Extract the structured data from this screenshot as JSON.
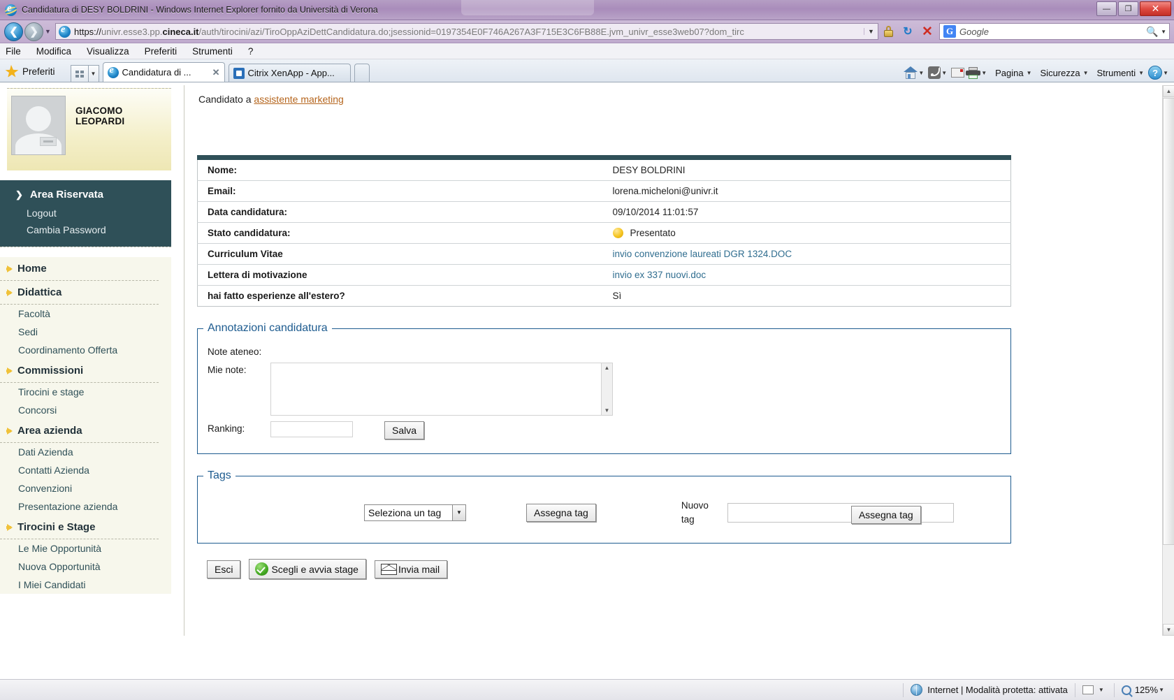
{
  "window": {
    "title": "Candidatura di DESY BOLDRINI - Windows Internet Explorer fornito da Università di Verona",
    "minimize_label": "—",
    "maximize_label": "❐",
    "close_label": "✕"
  },
  "address_bar": {
    "back_label": "❮",
    "forward_label": "❯",
    "history_caret": "▼",
    "url_scheme": "https://",
    "url_host_pre": "univr.esse3.pp.",
    "url_host_bold": "cineca.it",
    "url_path": "/auth/tirocini/azi/TiroOppAziDettCandidatura.do;jsessionid=0197354E0F746A267A3F715E3C6FB88E.jvm_univr_esse3web07?dom_tirc",
    "url_dropdown_caret": "▼",
    "lock_icon": "lock-icon",
    "refresh_label": "↻",
    "stop_label": "✕",
    "search_engine": "Google",
    "search_placeholder": "Google",
    "search_icon": "search-icon",
    "search_caret": "▼"
  },
  "menu_bar": {
    "items": [
      "File",
      "Modifica",
      "Visualizza",
      "Preferiti",
      "Strumenti",
      "?"
    ]
  },
  "tab_bar": {
    "favorites_label": "Preferiti",
    "quick_tabs_caret": "▼",
    "tabs": [
      {
        "label": "Candidatura di ...",
        "icon": "ie-icon",
        "active": true,
        "close_label": "✕"
      },
      {
        "label": "Citrix XenApp - App...",
        "icon": "citrix-icon",
        "active": false,
        "close_label": ""
      }
    ],
    "command_items": [
      {
        "label": "",
        "icon": "home-icon",
        "caret": "▼"
      },
      {
        "label": "",
        "icon": "rss-icon",
        "caret": "▼"
      },
      {
        "label": "",
        "icon": "mail-icon",
        "caret": ""
      },
      {
        "label": "",
        "icon": "print-icon",
        "caret": "▼"
      },
      {
        "label": "Pagina",
        "icon": "",
        "caret": "▼"
      },
      {
        "label": "Sicurezza",
        "icon": "",
        "caret": "▼"
      },
      {
        "label": "Strumenti",
        "icon": "",
        "caret": "▼"
      },
      {
        "label": "",
        "icon": "help-icon",
        "caret": "▼"
      }
    ]
  },
  "sidebar": {
    "user_name": "GIACOMO LEOPARDI",
    "avatar_icon": "user-avatar-icon",
    "reserved_area": {
      "title": "Area Riservata",
      "chevron": "❯",
      "links": [
        "Logout",
        "Cambia Password"
      ]
    },
    "groups": [
      {
        "label": "Home",
        "items": []
      },
      {
        "label": "Didattica",
        "items": [
          "Facoltà",
          "Sedi",
          "Coordinamento Offerta"
        ]
      },
      {
        "label": "Commissioni",
        "items": [
          "Tirocini e stage",
          "Concorsi"
        ]
      },
      {
        "label": "Area azienda",
        "items": [
          "Dati Azienda",
          "Contatti Azienda",
          "Convenzioni",
          "Presentazione azienda"
        ]
      },
      {
        "label": "Tirocini e Stage",
        "items": [
          "Le Mie Opportunità",
          "Nuova Opportunità",
          "I Miei Candidati"
        ]
      }
    ]
  },
  "main": {
    "candidato_prefix": "Candidato a ",
    "candidato_link": "assistente marketing",
    "info_rows": [
      {
        "key": "Nome:",
        "value": "DESY BOLDRINI",
        "type": "text"
      },
      {
        "key": "Email:",
        "value": "lorena.micheloni@univr.it",
        "type": "text"
      },
      {
        "key": "Data candidatura:",
        "value": "09/10/2014 11:01:57",
        "type": "text"
      },
      {
        "key": "Stato candidatura:",
        "value": "Presentato",
        "type": "status"
      },
      {
        "key": "Curriculum Vitae",
        "value": "invio convenzione laureati DGR 1324.DOC",
        "type": "link"
      },
      {
        "key": "Lettera di motivazione",
        "value": "invio ex 337 nuovi.doc",
        "type": "link"
      },
      {
        "key": "hai fatto esperienze all'estero?",
        "value": "Sì",
        "type": "text"
      }
    ],
    "annotations": {
      "legend": "Annotazioni candidatura",
      "note_ateneo_label": "Note ateneo:",
      "note_ateneo_value": "",
      "mie_note_label": "Mie note:",
      "mie_note_value": "",
      "ranking_label": "Ranking:",
      "ranking_value": "",
      "save_button": "Salva",
      "scroll_up": "▲",
      "scroll_down": "▼"
    },
    "tags": {
      "legend": "Tags",
      "select_value": "Seleziona un tag",
      "select_caret": "▼",
      "assign_button": "Assegna tag",
      "new_tag_label": "Nuovo tag",
      "new_tag_value": "",
      "new_tag_button": "Assegna tag"
    },
    "bottom_buttons": [
      {
        "label": "Esci",
        "icon": ""
      },
      {
        "label": "Scegli e avvia stage",
        "icon": "check-circle-icon"
      },
      {
        "label": "Invia mail",
        "icon": "envelope-icon"
      }
    ]
  },
  "status_bar": {
    "zone_icon": "globe-icon",
    "zone_text": "Internet | Modalità protetta: attivata",
    "zoom_level": "125%",
    "zoom_caret": "▼",
    "extra_caret": "▼"
  },
  "colors": {
    "sidebar_dark": "#2f5058",
    "accent_yellow": "#f0c23a",
    "link_orange": "#b5651d",
    "fieldset_blue": "#1d5b8f"
  }
}
